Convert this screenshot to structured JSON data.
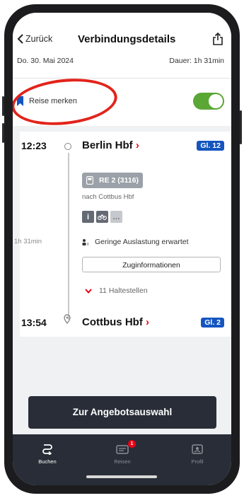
{
  "header": {
    "back_label": "Zurück",
    "title": "Verbindungsdetails",
    "date": "Do. 30. Mai 2024",
    "duration": "Dauer: 1h 31min"
  },
  "merken": {
    "label": "Reise merken",
    "toggle_on": true
  },
  "journey": {
    "departure": {
      "time": "12:23",
      "station": "Berlin Hbf",
      "chevron": "›",
      "platform": "Gl. 12"
    },
    "train": {
      "name": "RE 2 (3116)",
      "direction": "nach Cottbus Hbf"
    },
    "info_icons": [
      "i",
      "bike",
      "…"
    ],
    "duration": "1h 31min",
    "occupancy": "Geringe Auslastung erwartet",
    "train_info_button": "Zuginformationen",
    "stops": "11 Haltestellen",
    "arrival": {
      "time": "13:54",
      "station": "Cottbus Hbf",
      "chevron": "›",
      "platform": "Gl. 2"
    }
  },
  "cta": {
    "label": "Zur Angebotsauswahl"
  },
  "tabbar": {
    "tabs": [
      {
        "label": "Buchen",
        "icon": "route-icon",
        "active": true
      },
      {
        "label": "Reisen",
        "icon": "ticket-icon",
        "badge": "1"
      },
      {
        "label": "Profil",
        "icon": "profile-icon"
      }
    ]
  },
  "colors": {
    "accent_red": "#ec0016",
    "platform_blue": "#1455c0",
    "toggle_green": "#5aa735",
    "dark": "#282d37"
  }
}
